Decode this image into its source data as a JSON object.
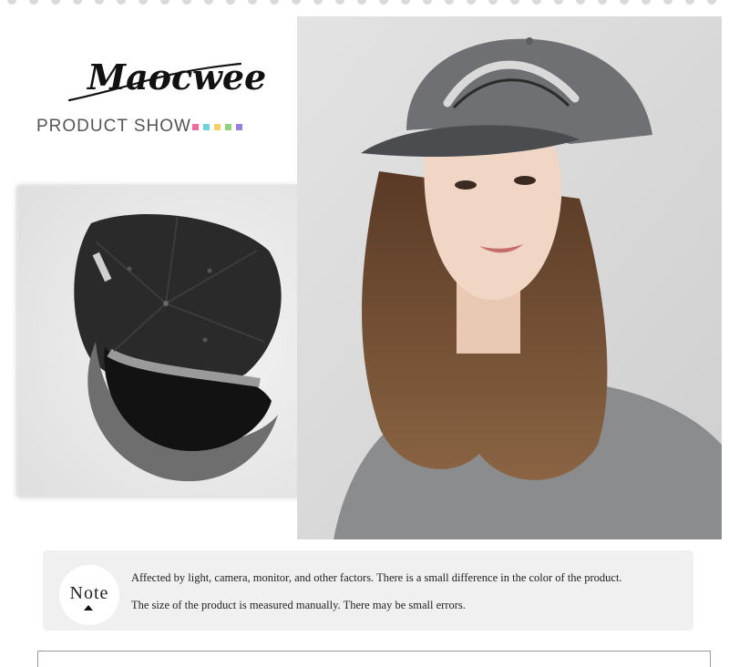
{
  "brand": {
    "logo_text": "Maocwee",
    "section_title": "PRODUCT SHOW",
    "color_swatches": [
      "#f06a9a",
      "#6fd3d8",
      "#f2d166",
      "#8fd27a",
      "#9b7fe0"
    ]
  },
  "images": {
    "left": "cap-underside-photo",
    "right": "model-wearing-cap-photo"
  },
  "note": {
    "label": "Note",
    "line1": "Affected by light, camera, monitor, and other factors. There is a small difference in the color of the product.",
    "line2": "The size of the product is measured manually. There may be small errors."
  }
}
